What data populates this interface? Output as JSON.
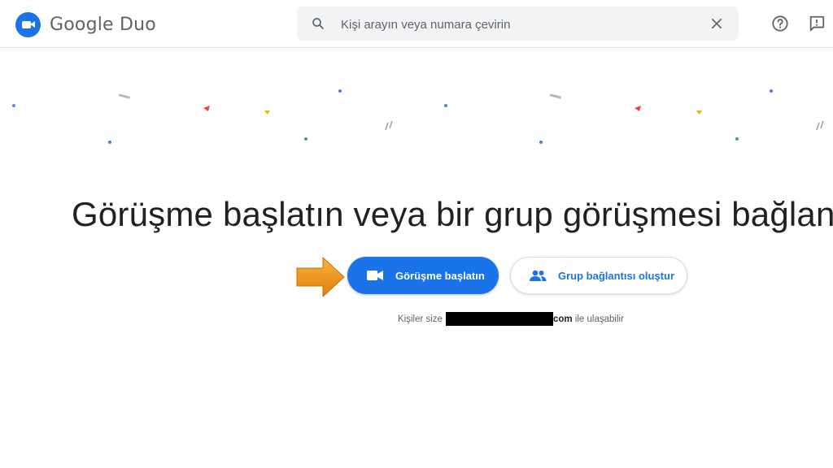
{
  "app": {
    "name": "Google Duo"
  },
  "header": {
    "search": {
      "placeholder": "Kişi arayın veya numara çevirin",
      "value": ""
    },
    "icons": [
      "search-icon",
      "close-icon",
      "help-icon",
      "feedback-icon"
    ]
  },
  "main": {
    "headline": "Görüşme başlatın veya bir grup görüşmesi bağlantısı o",
    "primary_button": "Görüşme başlatın",
    "secondary_button": "Grup bağlantısı oluştur",
    "reach": {
      "prefix": "Kişiler size",
      "suffix_bold": "com",
      "suffix": " ile ulaşabilir"
    }
  },
  "colors": {
    "brand_blue": "#1a73e8",
    "arrow_orange": "#f39a1c"
  }
}
